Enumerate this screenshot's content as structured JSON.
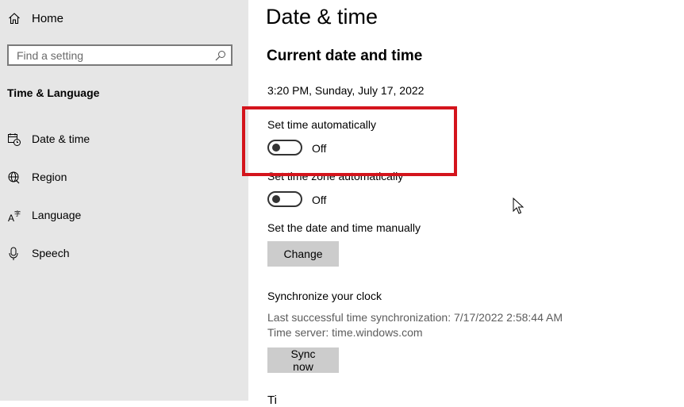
{
  "sidebar": {
    "home_label": "Home",
    "search_placeholder": "Find a setting",
    "section_title": "Time & Language",
    "items": [
      {
        "label": "Date & time",
        "icon": "calendar-clock-icon"
      },
      {
        "label": "Region",
        "icon": "globe-icon"
      },
      {
        "label": "Language",
        "icon": "language-icon"
      },
      {
        "label": "Speech",
        "icon": "microphone-icon"
      }
    ]
  },
  "main": {
    "title": "Date & time",
    "section_heading": "Current date and time",
    "current_datetime": "3:20 PM, Sunday, July 17, 2022",
    "set_time_auto": {
      "label": "Set time automatically",
      "state": "Off"
    },
    "set_timezone_auto": {
      "label": "Set time zone automatically",
      "state": "Off"
    },
    "manual": {
      "label": "Set the date and time manually",
      "button": "Change"
    },
    "sync": {
      "heading": "Synchronize your clock",
      "last_sync": "Last successful time synchronization: 7/17/2022 2:58:44 AM",
      "server": "Time server: time.windows.com",
      "button": "Sync now"
    },
    "next_heading_partial": "Ti"
  },
  "colors": {
    "sidebar_bg": "#e6e6e6",
    "highlight": "#d4141c",
    "button_bg": "#cccccc",
    "toggle_off": "#333333"
  }
}
